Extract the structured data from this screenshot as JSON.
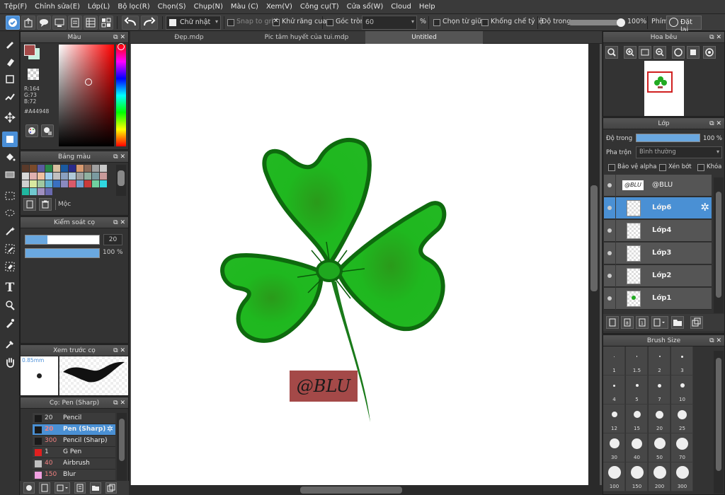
{
  "menu": [
    "Tệp(F)",
    "Chỉnh sửa(E)",
    "Lớp(L)",
    "Bộ lọc(R)",
    "Chọn(S)",
    "Chụp(N)",
    "Màu (C)",
    "Xem(V)",
    "Công cụ(T)",
    "Cửa sổ(W)",
    "Cloud",
    "Help"
  ],
  "toolbar": {
    "shape_select": "Chữ nhật",
    "snap_grid": "Snap to grid",
    "antialias": "Khử răng cưa",
    "round_corner": "Góc tròn",
    "round_value": "60",
    "percent": "%",
    "center_select": "Chọn từ giữa",
    "constrain_ratio": "Khống chế tỷ lệ",
    "opacity_label": "Độ trong",
    "opacity_value": "100%",
    "opacity_level": 1.0,
    "key_label": "Phím",
    "reset_label": "Đặt lại"
  },
  "color_panel": {
    "title": "Màu",
    "r": "R:164",
    "g": "G:73",
    "b": "B:72",
    "hex": "#A44948",
    "main_color": "#A44948",
    "sub_color": "#c8f0e0"
  },
  "palette_panel": {
    "title": "Bảng màu",
    "name": "Mộc",
    "colors": [
      "#5a3a2a",
      "#7a4a2a",
      "#5a5aa0",
      "#2a8a4a",
      "#d8c0a0",
      "#1a5aa0",
      "#2a2a8a",
      "#d89a70",
      "#8a6a5a",
      "#a0a0a0",
      "#c8c8c8",
      "#d8d8d8",
      "#e0b0b0",
      "#f0c0a0",
      "#a0d0f0",
      "#c0c0c0",
      "#8aa0c0",
      "#b0c8d8",
      "#a0a0a0",
      "#90b0a0",
      "#7a9aa0",
      "#c89a9a",
      "#d0d0d0",
      "#d8e8a0",
      "#a0c8a0",
      "#60b0d0",
      "#3a70c0",
      "#8a8ac0",
      "#d85a6a",
      "#70a0d0",
      "#c83a3a",
      "#70d0a0",
      "#30d8e0",
      "#20b8a0",
      "#70c8d0",
      "#a090c0",
      "#6a6ab0"
    ]
  },
  "brush_control": {
    "title": "Kiểm soát cọ",
    "size_value": "20",
    "size_level": 0.3,
    "opacity_value": "100 %",
    "opacity_level": 1.0
  },
  "brush_preview": {
    "title": "Xem trước cọ",
    "size": "0.85mm"
  },
  "brush_list": {
    "title": "Cọ: Pen (Sharp)",
    "items": [
      {
        "size": "20",
        "name": "Pencil",
        "color": "#1a1a1a",
        "selected": false
      },
      {
        "size": "20",
        "name": "Pen (Sharp)",
        "color": "#1a1a1a",
        "selected": true
      },
      {
        "size": "300",
        "name": "Pencil (Sharp)",
        "color": "#1a1a1a",
        "selected": false
      },
      {
        "size": "1",
        "name": "G Pen",
        "color": "#e02020",
        "selected": false
      },
      {
        "size": "40",
        "name": "Airbrush",
        "color": "#c0c0c0",
        "selected": false
      },
      {
        "size": "150",
        "name": "Blur",
        "color": "#f0a0e0",
        "selected": false
      }
    ]
  },
  "tabs": [
    "Đẹp.mdp",
    "Pic tâm huyết của tui.mdp",
    "Untitled"
  ],
  "canvas": {
    "watermark": "@BLU",
    "watermark_bg": "#A44948"
  },
  "navigator": {
    "title": "Hoa bêu"
  },
  "layer_panel": {
    "title": "Lớp",
    "opacity_label": "Độ trong",
    "opacity_value": "100 %",
    "opacity_level": 1.0,
    "blend_label": "Pha trộn",
    "blend_value": "Bình thường",
    "protect_alpha": "Bảo vệ alpha",
    "clipping": "Xén bớt",
    "lock": "Khóa",
    "layers": [
      {
        "name": "@BLU",
        "selected": false
      },
      {
        "name": "Lớp6",
        "selected": true
      },
      {
        "name": "Lớp4",
        "selected": false
      },
      {
        "name": "Lớp3",
        "selected": false
      },
      {
        "name": "Lớp2",
        "selected": false
      },
      {
        "name": "Lớp1",
        "selected": false
      }
    ]
  },
  "brush_size_panel": {
    "title": "Brush Size",
    "sizes": [
      "1",
      "1.5",
      "2",
      "3",
      "4",
      "5",
      "7",
      "10",
      "12",
      "15",
      "20",
      "25",
      "30",
      "40",
      "50",
      "70",
      "100",
      "150",
      "200",
      "300"
    ]
  }
}
